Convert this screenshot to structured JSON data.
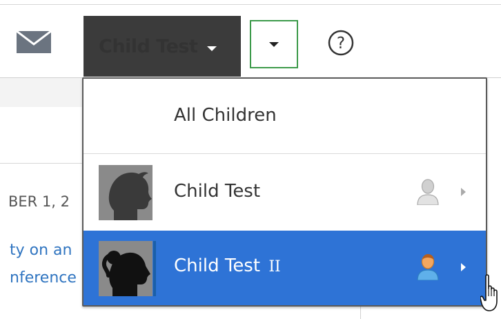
{
  "header": {
    "selected_child": "Child Test",
    "mail_icon": "envelope-icon",
    "help_icon": "question-circle-icon",
    "colors": {
      "selector_bg": "#3b3b3b",
      "dropdown_border": "#3c9a4a"
    }
  },
  "background_page": {
    "date_fragment": "BER 1, 2",
    "link_line_1": "ty on an",
    "link_line_2": "nference"
  },
  "menu": {
    "items": [
      {
        "label": "All Children",
        "suffix": "",
        "avatar": "",
        "state": "normal"
      },
      {
        "label": "Child Test",
        "suffix": "",
        "avatar": "boy-silhouette",
        "person_icon": "person-gray-icon",
        "state": "normal"
      },
      {
        "label": "Child Test",
        "suffix": "II",
        "avatar": "girl-silhouette",
        "person_icon": "person-orange-icon",
        "state": "highlighted"
      }
    ],
    "colors": {
      "highlight": "#2e73d6",
      "avatar_bg": "#8a8a8a"
    }
  }
}
